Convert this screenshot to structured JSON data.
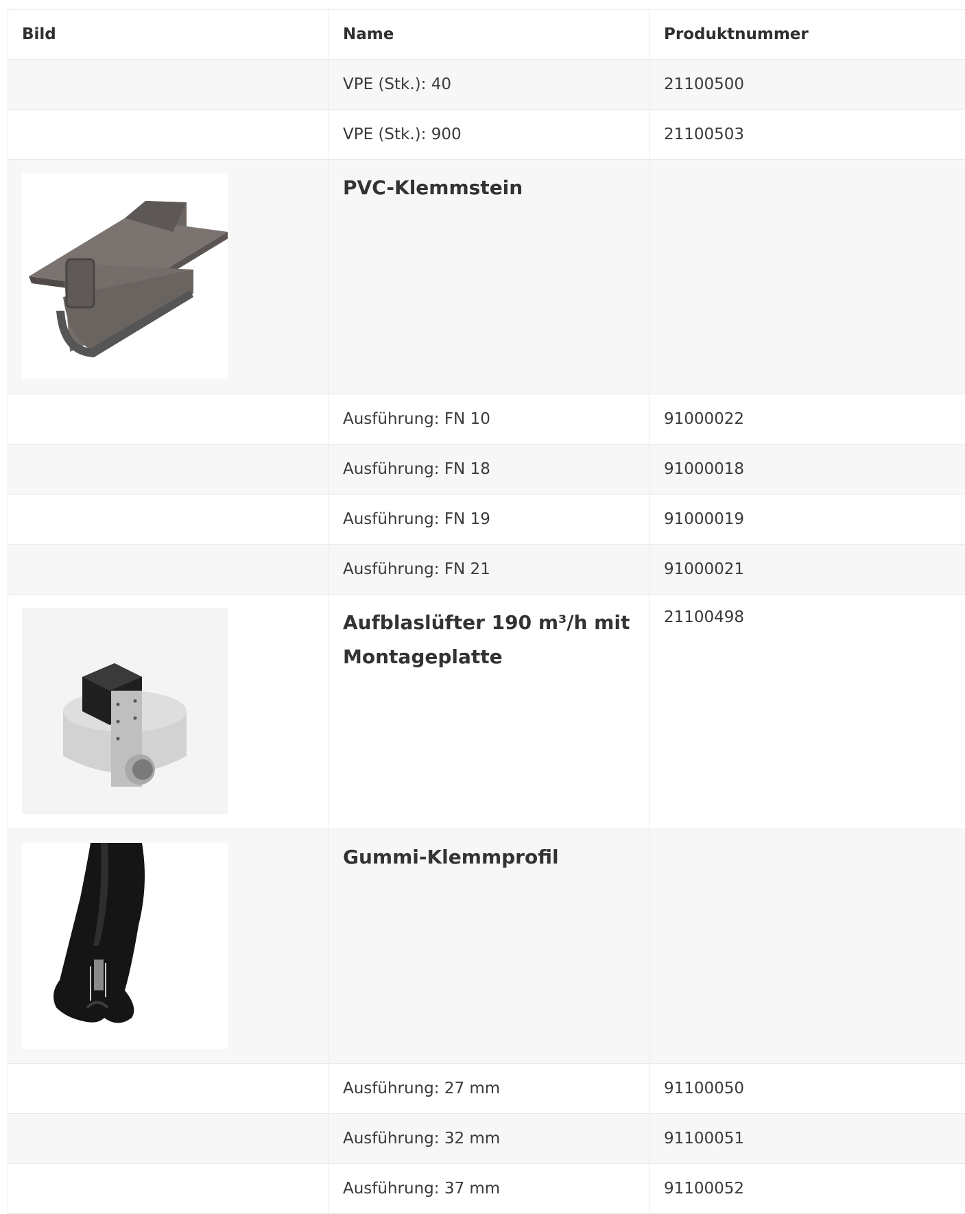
{
  "table": {
    "headers": {
      "image": "Bild",
      "name": "Name",
      "number": "Produktnummer"
    },
    "rows": [
      {
        "kind": "variant",
        "name": "VPE (Stk.): 40",
        "number": "21100500"
      },
      {
        "kind": "variant",
        "name": "VPE (Stk.): 900",
        "number": "21100503"
      },
      {
        "kind": "product",
        "image": "pvc-clamp-image",
        "name": "PVC-Klemmstein",
        "number": ""
      },
      {
        "kind": "variant",
        "name": "Ausführung: FN 10",
        "number": "91000022"
      },
      {
        "kind": "variant",
        "name": "Ausführung: FN 18",
        "number": "91000018"
      },
      {
        "kind": "variant",
        "name": "Ausführung: FN 19",
        "number": "91000019"
      },
      {
        "kind": "variant",
        "name": "Ausführung: FN 21",
        "number": "91000021"
      },
      {
        "kind": "product",
        "image": "blower-image",
        "name": "Aufblaslüfter 190 m³/h mit Montageplatte",
        "number": "21100498"
      },
      {
        "kind": "product",
        "image": "rubber-profile-image",
        "name": "Gummi-Klemmprofil",
        "number": ""
      },
      {
        "kind": "variant",
        "name": "Ausführung: 27 mm",
        "number": "91100050"
      },
      {
        "kind": "variant",
        "name": "Ausführung: 32 mm",
        "number": "91100051"
      },
      {
        "kind": "variant",
        "name": "Ausführung: 37 mm",
        "number": "91100052"
      }
    ]
  }
}
